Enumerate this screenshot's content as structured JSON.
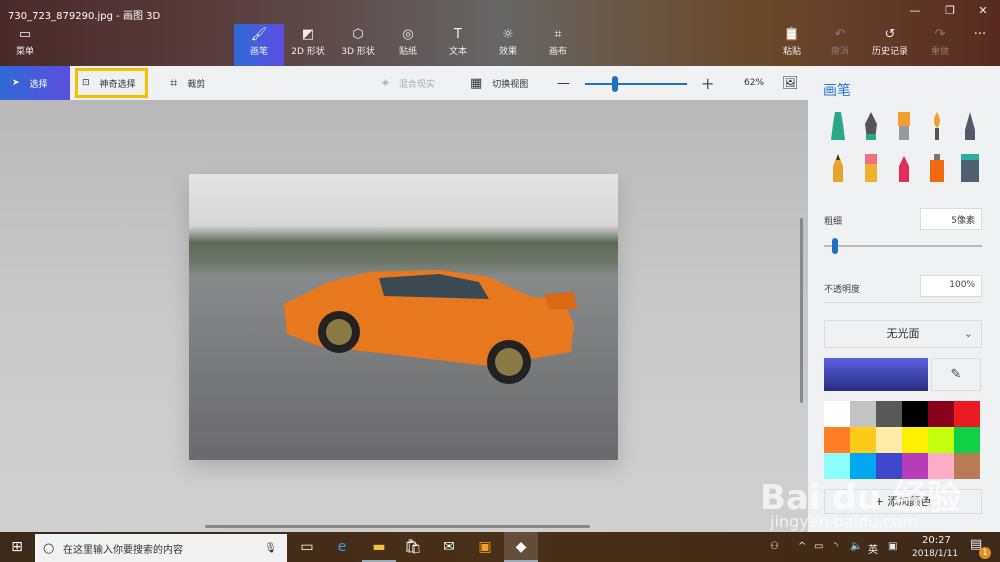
{
  "window": {
    "title": "730_723_879290.jpg - 画图 3D",
    "minimize": "—",
    "restore": "❐",
    "close": "✕"
  },
  "ribbon": {
    "menu": "菜单",
    "tabs": [
      {
        "label": "画笔",
        "icon": "brush-icon"
      },
      {
        "label": "2D 形状",
        "icon": "shapes-2d-icon"
      },
      {
        "label": "3D 形状",
        "icon": "cube-icon"
      },
      {
        "label": "贴纸",
        "icon": "sticker-icon"
      },
      {
        "label": "文本",
        "icon": "text-icon"
      },
      {
        "label": "效果",
        "icon": "sun-icon"
      },
      {
        "label": "画布",
        "icon": "canvas-icon"
      }
    ],
    "paste": "粘贴",
    "undo": "撤消",
    "history": "历史记录",
    "redo": "重做",
    "more": "···"
  },
  "toolbar": {
    "select": "选择",
    "magic_select": "神奇选择",
    "crop": "裁剪",
    "mixed_reality": "混合现实",
    "toggle_view": "切换视图",
    "zoom_minus": "—",
    "zoom_plus": "+",
    "zoom": "62%",
    "zoom_fraction": 0.15
  },
  "panel": {
    "title": "画笔",
    "thickness_label": "粗细",
    "thickness": "5像素",
    "thickness_fraction": 0.03,
    "opacity_label": "不透明度",
    "opacity": "100%",
    "finish": "无光面",
    "current_color": "#4a4fd0",
    "swatches": [
      "#ffffff",
      "#c3c3c3",
      "#585858",
      "#000000",
      "#88001b",
      "#ec1c24",
      "#ff7f27",
      "#ffca18",
      "#fdeca6",
      "#fff200",
      "#c4ff0e",
      "#0ed145",
      "#8cfffb",
      "#00a8f3",
      "#3f48cc",
      "#b83dba",
      "#ffaec8",
      "#b97a56"
    ],
    "add_color": "+ 添加颜色"
  },
  "taskbar": {
    "search_placeholder": "在这里输入你要搜索的内容",
    "ime": "英",
    "time": "20:27",
    "date": "2018/1/11",
    "notifications": "1"
  },
  "watermark": {
    "text": "Bai du 经验",
    "url": "jingyan.baidu.com"
  }
}
